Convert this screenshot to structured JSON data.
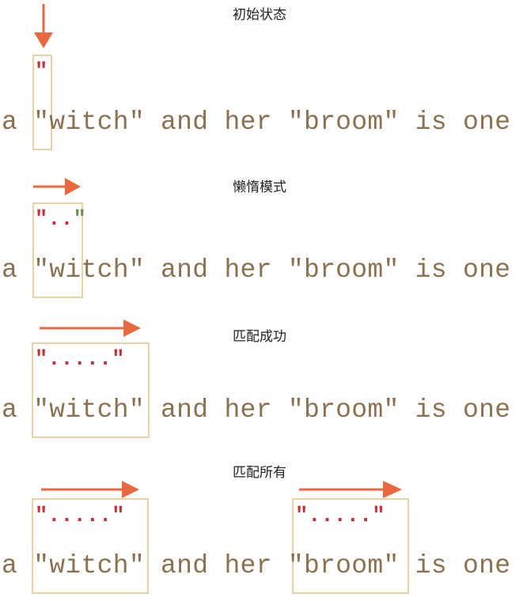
{
  "sentence": "a \"witch\" and her \"broom\" is one",
  "palette": {
    "arrow": "#e8693f",
    "box": "#ecd1a4",
    "text": "#8a7150",
    "quote": "#c8303a",
    "open_quote": "#6f8c5d"
  },
  "steps": [
    {
      "caption": "初始状态",
      "pattern": "\"",
      "arrow": "down"
    },
    {
      "caption": "懒惰模式",
      "pattern": "\"..",
      "pattern_tail": "\"",
      "arrow": "right"
    },
    {
      "caption": "匹配成功",
      "pattern": "\".....\"",
      "arrow": "right"
    },
    {
      "caption": "匹配所有",
      "patterns": [
        "\".....\"",
        "\".....\""
      ],
      "arrow": "right"
    }
  ]
}
